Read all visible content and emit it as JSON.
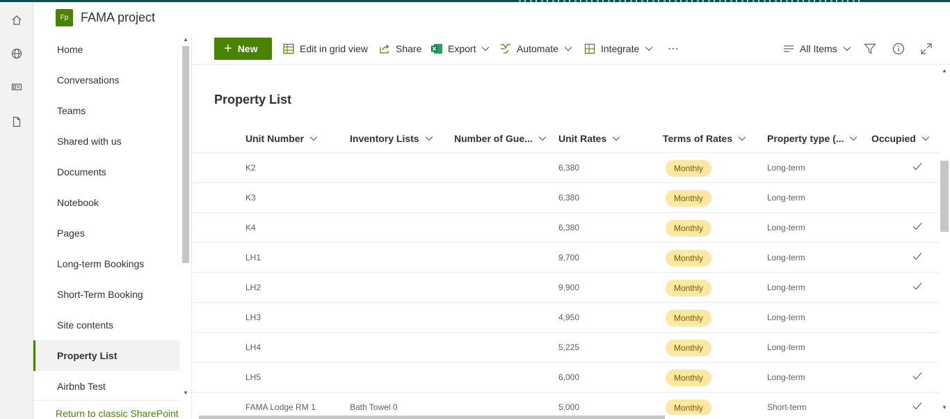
{
  "site": {
    "logo": "Fp",
    "title": "FAMA project"
  },
  "suite_rail": {
    "icons": [
      "home-icon",
      "globe-icon",
      "news-icon",
      "document-icon"
    ]
  },
  "nav": {
    "items": [
      {
        "label": "Home",
        "selected": false
      },
      {
        "label": "Conversations",
        "selected": false
      },
      {
        "label": "Teams",
        "selected": false
      },
      {
        "label": "Shared with us",
        "selected": false
      },
      {
        "label": "Documents",
        "selected": false
      },
      {
        "label": "Notebook",
        "selected": false
      },
      {
        "label": "Pages",
        "selected": false
      },
      {
        "label": "Long-term Bookings",
        "selected": false
      },
      {
        "label": "Short-Term Booking",
        "selected": false
      },
      {
        "label": "Site contents",
        "selected": false
      },
      {
        "label": "Property List",
        "selected": true
      },
      {
        "label": "Airbnb Test",
        "selected": false
      }
    ],
    "return_link": "Return to classic SharePoint"
  },
  "commandbar": {
    "new": "New",
    "edit_grid": "Edit in grid view",
    "share": "Share",
    "export": "Export",
    "automate": "Automate",
    "integrate": "Integrate",
    "more": "⋯",
    "view": "All Items"
  },
  "list": {
    "title": "Property List",
    "columns": [
      "Unit Number",
      "Inventory Lists",
      "Number of Gue...",
      "Unit Rates",
      "Terms of Rates",
      "Property type (...",
      "Occupied"
    ],
    "rows": [
      {
        "unit": "K2",
        "inventory": "",
        "guests": "",
        "rate": "6,380",
        "terms": "Monthly",
        "type": "Long-term",
        "occupied": true
      },
      {
        "unit": "K3",
        "inventory": "",
        "guests": "",
        "rate": "6,380",
        "terms": "Monthly",
        "type": "Long-term",
        "occupied": false
      },
      {
        "unit": "K4",
        "inventory": "",
        "guests": "",
        "rate": "6,380",
        "terms": "Monthly",
        "type": "Long-term",
        "occupied": true
      },
      {
        "unit": "LH1",
        "inventory": "",
        "guests": "",
        "rate": "9,700",
        "terms": "Monthly",
        "type": "Long-term",
        "occupied": true
      },
      {
        "unit": "LH2",
        "inventory": "",
        "guests": "",
        "rate": "9,900",
        "terms": "Monthly",
        "type": "Long-term",
        "occupied": true
      },
      {
        "unit": "LH3",
        "inventory": "",
        "guests": "",
        "rate": "4,950",
        "terms": "Monthly",
        "type": "Long-term",
        "occupied": false
      },
      {
        "unit": "LH4",
        "inventory": "",
        "guests": "",
        "rate": "5,225",
        "terms": "Monthly",
        "type": "Long-term",
        "occupied": false
      },
      {
        "unit": "LH5",
        "inventory": "",
        "guests": "",
        "rate": "6,000",
        "terms": "Monthly",
        "type": "Long-term",
        "occupied": true
      },
      {
        "unit": "FAMA Lodge RM 1",
        "inventory": "Bath Towel 0",
        "guests": "",
        "rate": "5,000",
        "terms": "Monthly",
        "type": "Short-term",
        "occupied": true
      }
    ]
  },
  "colors": {
    "brand": "#498205",
    "pill_bg": "#fce8a3",
    "pill_text": "#7a5c00"
  }
}
